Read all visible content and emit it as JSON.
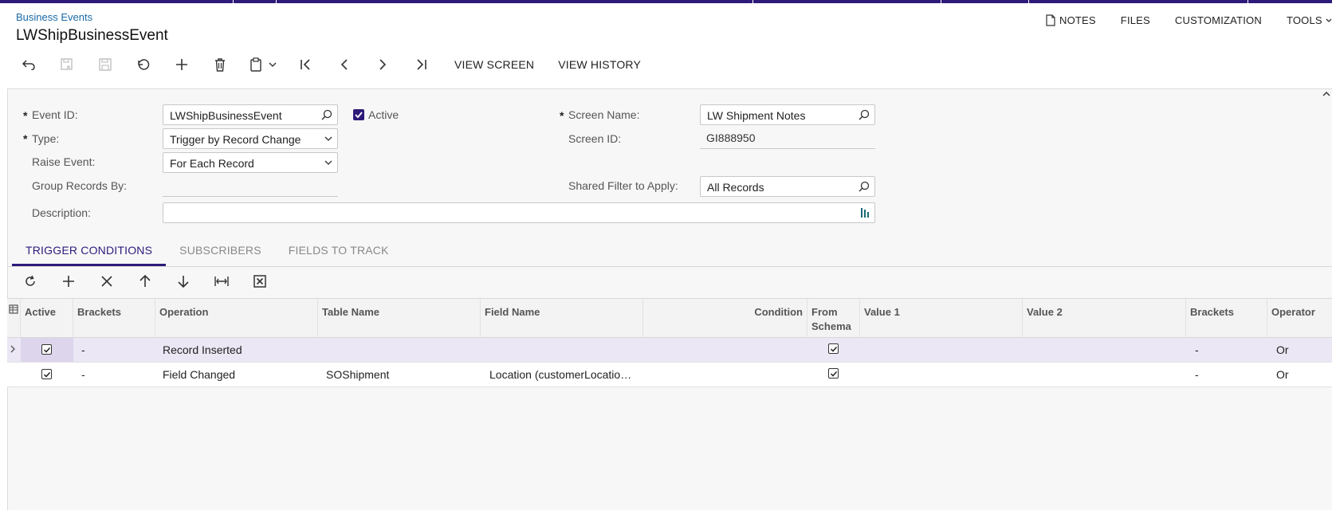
{
  "header": {
    "breadcrumb": "Business Events",
    "title": "LWShipBusinessEvent"
  },
  "topnav": {
    "notes": "NOTES",
    "files": "FILES",
    "customization": "CUSTOMIZATION",
    "tools": "TOOLS"
  },
  "toolbar": {
    "view_screen": "VIEW SCREEN",
    "view_history": "VIEW HISTORY"
  },
  "form": {
    "event_id_label": "Event ID:",
    "event_id_value": "LWShipBusinessEvent",
    "active_label": "Active",
    "type_label": "Type:",
    "type_value": "Trigger by Record Change",
    "raise_event_label": "Raise Event:",
    "raise_event_value": "For Each Record",
    "group_records_label": "Group Records By:",
    "description_label": "Description:",
    "description_value": "",
    "screen_name_label": "Screen Name:",
    "screen_name_value": "LW Shipment Notes",
    "screen_id_label": "Screen ID:",
    "screen_id_value": "GI888950",
    "shared_filter_label": "Shared Filter to Apply:",
    "shared_filter_value": "All Records",
    "required_mark": "*"
  },
  "tabs": [
    "TRIGGER CONDITIONS",
    "SUBSCRIBERS",
    "FIELDS TO TRACK"
  ],
  "grid": {
    "columns": [
      "Active",
      "Brackets",
      "Operation",
      "Table Name",
      "Field Name",
      "Condition",
      "From Schema",
      "Value 1",
      "Value 2",
      "Brackets",
      "Operator"
    ],
    "rows": [
      {
        "active": true,
        "brackets": "-",
        "operation": "Record Inserted",
        "table": "",
        "field": "",
        "condition": "",
        "from_schema": true,
        "value1": "",
        "value2": "",
        "brackets2": "-",
        "operator": "Or"
      },
      {
        "active": true,
        "brackets": "-",
        "operation": "Field Changed",
        "table": "SOShipment",
        "field": "Location (customerLocatio…",
        "condition": "",
        "from_schema": true,
        "value1": "",
        "value2": "",
        "brackets2": "-",
        "operator": "Or"
      }
    ]
  },
  "colors": {
    "accent": "#2e1a7a",
    "link": "#1a6aa8",
    "selected_row": "#ebe7f4"
  }
}
